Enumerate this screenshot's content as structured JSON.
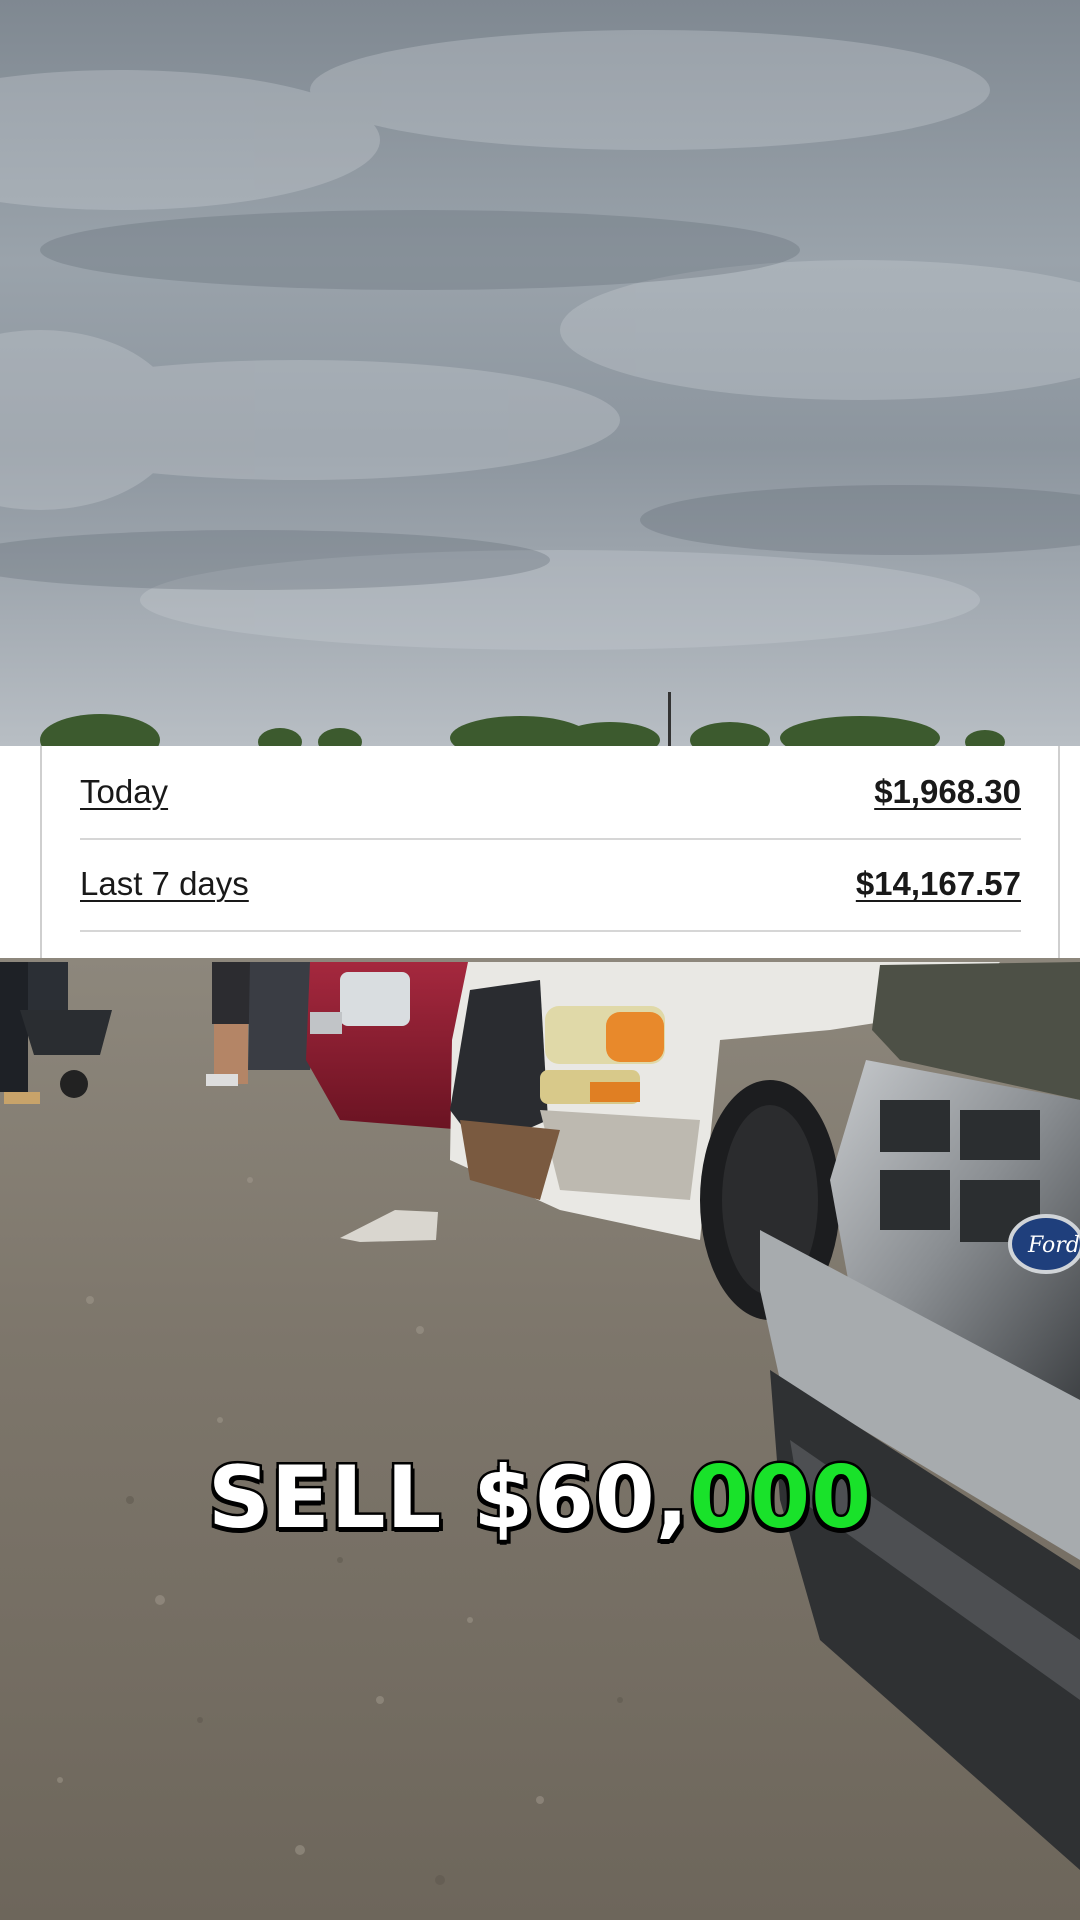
{
  "earnings": {
    "today_label": "Today",
    "today_value": "$1,968.30",
    "week_label": "Last 7 days",
    "week_value": "$14,167.57"
  },
  "caption": {
    "part_white": "SELL $60,",
    "part_green": "000",
    "highlight_color": "#19e22a"
  },
  "scene": {
    "logo_text": "Ford"
  }
}
